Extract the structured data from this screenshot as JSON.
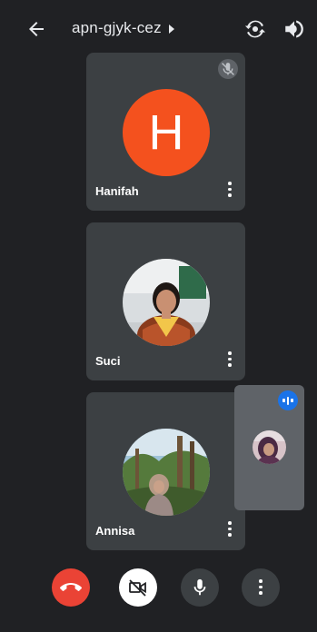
{
  "header": {
    "meeting_code": "apn-gjyk-cez",
    "icons": [
      "back-arrow-icon",
      "caret-right-icon",
      "switch-camera-icon",
      "speaker-icon"
    ]
  },
  "participants": [
    {
      "name": "Hanifah",
      "avatar_letter": "H",
      "avatar_color": "#f4511e",
      "muted": true
    },
    {
      "name": "Suci",
      "avatar": "photo"
    },
    {
      "name": "Annisa",
      "avatar": "photo"
    }
  ],
  "self_view": {
    "speaking_indicator_color": "#1a73e8"
  },
  "controls": {
    "end_call_color": "#ea4335",
    "icons": [
      "end-call-icon",
      "camera-off-icon",
      "microphone-icon",
      "more-options-icon"
    ]
  },
  "colors": {
    "background": "#202124",
    "tile": "#3c4043"
  }
}
